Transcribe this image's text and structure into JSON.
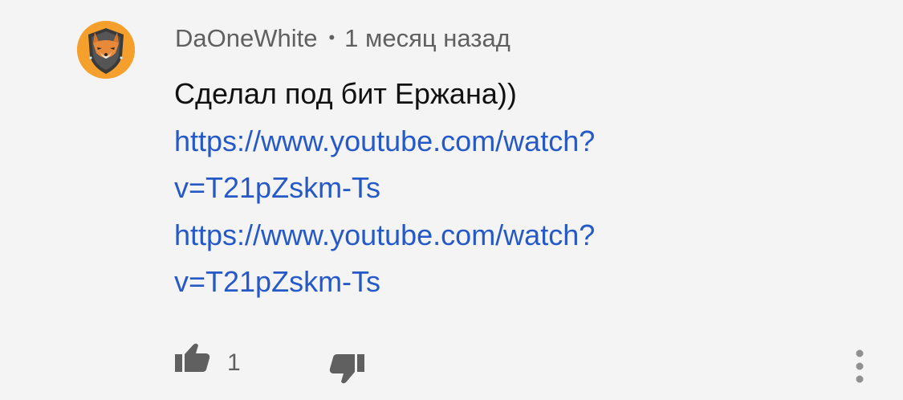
{
  "comment": {
    "author": "DaOneWhite",
    "separator": "•",
    "timestamp": "1 месяц назад",
    "text_lines": [
      "Сделал под бит Ержана))"
    ],
    "links": [
      {
        "line1": "https://www.youtube.com/watch?",
        "line2": "v=T21pZskm-Ts"
      },
      {
        "line1": "https://www.youtube.com/watch?",
        "line2": "v=T21pZskm-Ts"
      }
    ],
    "like_count": "1"
  },
  "icons": {
    "avatar": "fox-shield-avatar",
    "like": "thumbs-up-icon",
    "dislike": "thumbs-down-icon",
    "menu": "more-vertical-icon"
  },
  "colors": {
    "background": "#f4f4f4",
    "meta_text": "#606060",
    "body_text": "#111111",
    "link": "#2659c8",
    "icon": "#606060",
    "avatar_bg": "#f5a02c"
  }
}
